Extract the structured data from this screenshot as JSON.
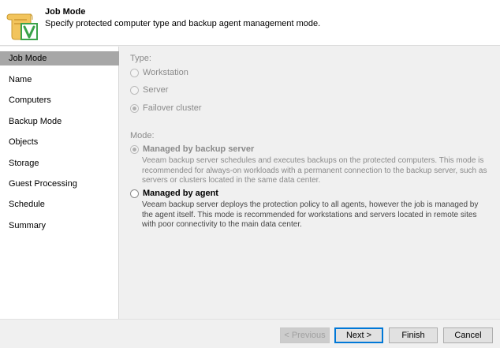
{
  "header": {
    "title": "Job Mode",
    "subtitle": "Specify protected computer type and backup agent management mode."
  },
  "sidebar": {
    "items": [
      {
        "label": "Job Mode",
        "active": true
      },
      {
        "label": "Name",
        "active": false
      },
      {
        "label": "Computers",
        "active": false
      },
      {
        "label": "Backup Mode",
        "active": false
      },
      {
        "label": "Objects",
        "active": false
      },
      {
        "label": "Storage",
        "active": false
      },
      {
        "label": "Guest Processing",
        "active": false
      },
      {
        "label": "Schedule",
        "active": false
      },
      {
        "label": "Summary",
        "active": false
      }
    ]
  },
  "type_section": {
    "label": "Type:",
    "options": [
      {
        "label": "Workstation",
        "selected": false
      },
      {
        "label": "Server",
        "selected": false
      },
      {
        "label": "Failover cluster",
        "selected": true
      }
    ]
  },
  "mode_section": {
    "label": "Mode:",
    "options": [
      {
        "label": "Managed by backup server",
        "selected": true,
        "description": "Veeam backup server schedules and executes backups on the protected computers. This mode is recommended for always-on workloads with a permanent connection to the backup server, such as servers or clusters located in the same data center."
      },
      {
        "label": "Managed by agent",
        "selected": false,
        "description": "Veeam backup server deploys the protection policy to all agents, however the job is managed by the agent itself. This mode is recommended for workstations and servers located in remote sites with poor connectivity to the main data center."
      }
    ]
  },
  "footer": {
    "previous_label": "< Previous",
    "next_label": "Next >",
    "finish_label": "Finish",
    "cancel_label": "Cancel"
  },
  "colors": {
    "accent": "#0078d7",
    "active_item": "#a7a7a7",
    "check_green": "#3aa34a"
  },
  "icons": {
    "header": "scroll-checkmark-icon"
  }
}
